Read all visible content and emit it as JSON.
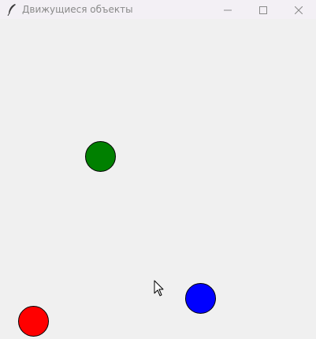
{
  "window": {
    "title": "Движущиеся объекты",
    "app_icon": "feather-icon",
    "controls": [
      "minimize-icon",
      "maximize-icon",
      "close-icon"
    ]
  },
  "canvas": {
    "background": "#f0f0f0",
    "objects": [
      {
        "name": "green-ball",
        "color": "#008000"
      },
      {
        "name": "blue-ball",
        "color": "#0000ff"
      },
      {
        "name": "red-ball",
        "color": "#ff0000"
      }
    ]
  }
}
